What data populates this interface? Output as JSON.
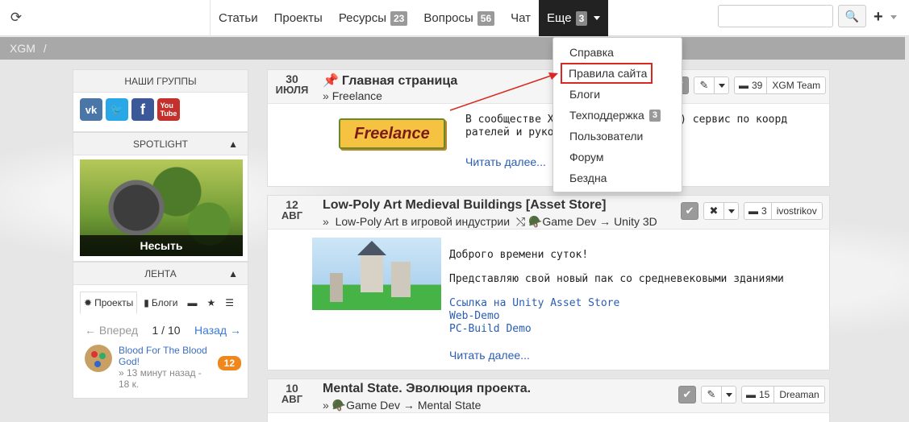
{
  "topbar": {
    "nav": [
      {
        "label": "Статьи",
        "count": ""
      },
      {
        "label": "Проекты",
        "count": ""
      },
      {
        "label": "Ресурсы",
        "count": "23"
      },
      {
        "label": "Вопросы",
        "count": "56"
      },
      {
        "label": "Чат",
        "count": ""
      },
      {
        "label": "Еще",
        "count": "3"
      }
    ],
    "search_placeholder": ""
  },
  "breadcrumb": {
    "root": "XGM",
    "sep": "/"
  },
  "more_menu": [
    {
      "label": "Справка",
      "count": ""
    },
    {
      "label": "Правила сайта",
      "count": ""
    },
    {
      "label": "Блоги",
      "count": ""
    },
    {
      "label": "Техподдержка",
      "count": "3"
    },
    {
      "label": "Пользователи",
      "count": ""
    },
    {
      "label": "Форум",
      "count": ""
    },
    {
      "label": "Бездна",
      "count": ""
    }
  ],
  "sidebar": {
    "groups_title": "НАШИ ГРУППЫ",
    "socials": [
      "vk",
      "twitter",
      "facebook",
      "youtube"
    ],
    "spotlight_title": "SPOTLIGHT",
    "spotlight_caption": "Несыть",
    "feed_title": "ЛЕНТА",
    "feed_tabs": {
      "projects": "Проекты",
      "blogs": "Блоги"
    },
    "pager": {
      "prev": "← Вперед",
      "page": "1 / 10",
      "next": "Назад →"
    },
    "feed_item": {
      "title": "Blood For The Blood God!",
      "meta": "» 13 минут назад - 18 к.",
      "badge": "12"
    }
  },
  "posts": [
    {
      "day": "30",
      "month": "ИЮЛЯ",
      "title": "Главная страница",
      "sub_arrow": "»",
      "sub": "Freelance",
      "comments": "39",
      "author": "XGM Team",
      "logo_text": "Freelance",
      "text": "В сообществе XG                                    (бета-тестирования) сервис по коорд                        рателей и руководителей проектов.",
      "read_more": "Читать далее..."
    },
    {
      "day": "12",
      "month": "АВГ",
      "title": "Low-Poly Art Medieval Buildings [Asset Store]",
      "sub_arrow": "»",
      "sub": "Low-Poly Art в игровой индустрии",
      "sub2": "Game Dev → Unity 3D",
      "comments": "3",
      "author": "ivostrikov",
      "lines": [
        "Доброго времени суток!",
        "Представляю свой новый пак со средневековыми зданиями"
      ],
      "links": [
        "Ссылка на Unity Asset Store",
        "Web-Demo",
        "PC-Build Demo"
      ],
      "read_more": "Читать далее..."
    },
    {
      "day": "10",
      "month": "АВГ",
      "title": "Mental State. Эволюция проекта.",
      "sub_arrow": "»",
      "sub": "Game Dev → Mental State",
      "comments": "15",
      "author": "Dreaman"
    }
  ],
  "colors": {
    "accent_link": "#2a5db0",
    "highlight_red": "#d9281f",
    "badge_orange": "#f0871c"
  }
}
